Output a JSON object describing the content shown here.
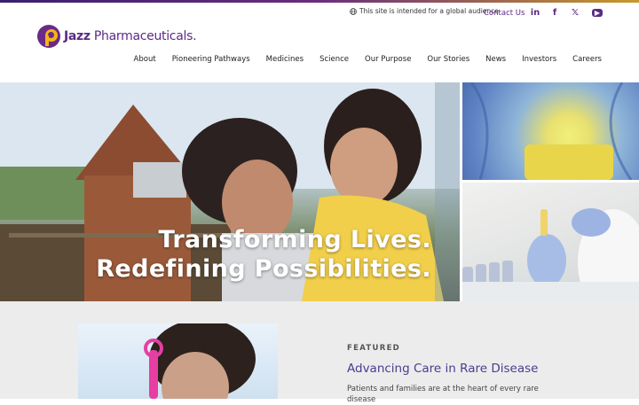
{
  "utility": {
    "global_notice": "This site is intended for a global audience",
    "contact": "Contact Us",
    "social": [
      {
        "icon": "linkedin-icon",
        "glyph": "in"
      },
      {
        "icon": "facebook-icon",
        "glyph": "f"
      },
      {
        "icon": "x-icon",
        "glyph": "𝕏"
      },
      {
        "icon": "youtube-icon",
        "glyph": "▶"
      }
    ]
  },
  "brand": {
    "name_bold": "Jazz",
    "name_rest": " Pharmaceuticals",
    "mark": ".",
    "colors": {
      "purple": "#5b2a86",
      "gold": "#f4b41a"
    }
  },
  "nav": {
    "items": [
      "About",
      "Pioneering Pathways",
      "Medicines",
      "Science",
      "Our Purpose",
      "Our Stories",
      "News",
      "Investors",
      "Careers"
    ]
  },
  "hero": {
    "line1": "Transforming Lives.",
    "line2": "Redefining Possibilities."
  },
  "featured": {
    "eyebrow": "FEATURED",
    "title": "Advancing Care in Rare Disease",
    "body": "Patients and families are at the heart of every rare disease"
  }
}
